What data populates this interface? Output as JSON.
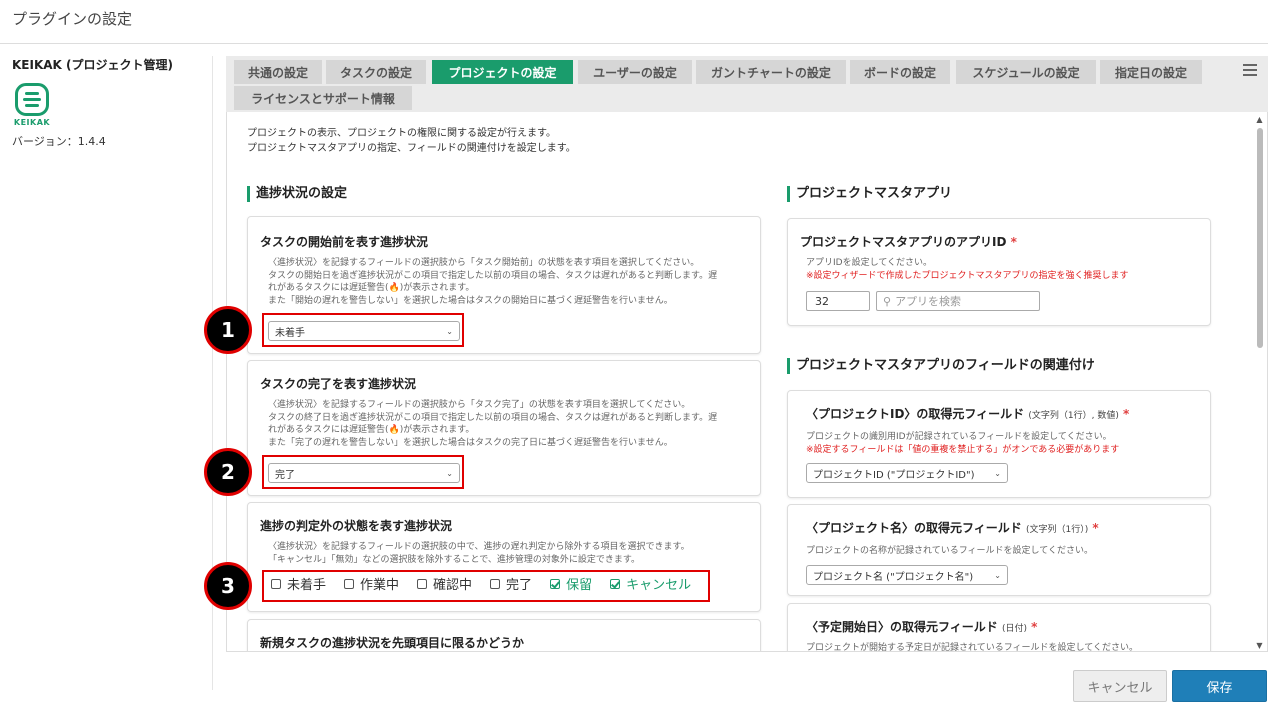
{
  "page_title": "プラグインの設定",
  "sidebar": {
    "plugin_name": "KEIKAK (プロジェクト管理)",
    "logo_text": "KEIKAK",
    "version": "バージョン：1.4.4"
  },
  "tabs": [
    {
      "label": "共通の設定",
      "active": false
    },
    {
      "label": "タスクの設定",
      "active": false
    },
    {
      "label": "プロジェクトの設定",
      "active": true
    },
    {
      "label": "ユーザーの設定",
      "active": false
    },
    {
      "label": "ガントチャートの設定",
      "active": false
    },
    {
      "label": "ボードの設定",
      "active": false
    },
    {
      "label": "スケジュールの設定",
      "active": false
    },
    {
      "label": "指定日の設定",
      "active": false
    },
    {
      "label": "ライセンスとサポート情報",
      "active": false
    }
  ],
  "intro": {
    "line1": "プロジェクトの表示、プロジェクトの権限に関する設定が行えます。",
    "line2": "プロジェクトマスタアプリの指定、フィールドの関連付けを設定します。"
  },
  "left_section": {
    "title": "進捗状況の設定",
    "start_card": {
      "title": "タスクの開始前を表す進捗状況",
      "desc1": "〈進捗状況〉を記録するフィールドの選択肢から「タスク開始前」の状態を表す項目を選択してください。",
      "desc2": "タスクの開始日を過ぎ進捗状況がこの項目で指定した以前の項目の場合、タスクは遅れがあると判断します。遅",
      "desc3": "れがあるタスクには遅延警告(🔥)が表示されます。",
      "desc4": "また「開始の遅れを警告しない」を選択した場合はタスクの開始日に基づく遅延警告を行いません。",
      "select_value": "未着手"
    },
    "end_card": {
      "title": "タスクの完了を表す進捗状況",
      "desc1": "〈進捗状況〉を記録するフィールドの選択肢から「タスク完了」の状態を表す項目を選択してください。",
      "desc2": "タスクの終了日を過ぎ進捗状況がこの項目で指定した以前の項目の場合、タスクは遅れがあると判断します。遅",
      "desc3": "れがあるタスクには遅延警告(🔥)が表示されます。",
      "desc4": "また「完了の遅れを警告しない」を選択した場合はタスクの完了日に基づく遅延警告を行いません。",
      "select_value": "完了"
    },
    "exclude_card": {
      "title": "進捗の判定外の状態を表す進捗状況",
      "desc1": "〈進捗状況〉を記録するフィールドの選択肢の中で、進捗の遅れ判定から除外する項目を選択できます。",
      "desc2": "「キャンセル」「無効」などの選択肢を除外することで、進捗管理の対象外に設定できます。",
      "options": [
        {
          "label": "未着手",
          "checked": false
        },
        {
          "label": "作業中",
          "checked": false
        },
        {
          "label": "確認中",
          "checked": false
        },
        {
          "label": "完了",
          "checked": false
        },
        {
          "label": "保留",
          "checked": true
        },
        {
          "label": "キャンセル",
          "checked": true
        }
      ]
    },
    "new_task_card": {
      "title": "新規タスクの進捗状況を先頭項目に限るかどうか"
    }
  },
  "right_section": {
    "master_title": "プロジェクトマスタアプリ",
    "app_id_card": {
      "title": "プロジェクトマスタアプリのアプリID",
      "required": "*",
      "desc1": "アプリIDを設定してください。",
      "desc2": "※設定ウィザードで作成したプロジェクトマスタアプリの指定を強く推奨します",
      "id_value": "32",
      "search_placeholder": "アプリを検索"
    },
    "link_title": "プロジェクトマスタアプリのフィールドの関連付け",
    "pid_card": {
      "title": "〈プロジェクトID〉の取得元フィールド",
      "type": "(文字列（1行）, 数値)",
      "required": "*",
      "desc1": "プロジェクトの識別用IDが記録されているフィールドを設定してください。",
      "desc2": "※設定するフィールドは「値の重複を禁止する」がオンである必要があります",
      "select_value": "プロジェクトID (\"プロジェクトID\")"
    },
    "pname_card": {
      "title": "〈プロジェクト名〉の取得元フィールド",
      "type": "(文字列（1行）)",
      "required": "*",
      "desc1": "プロジェクトの名称が記録されているフィールドを設定してください。",
      "select_value": "プロジェクト名 (\"プロジェクト名\")"
    },
    "pstart_card": {
      "title": "〈予定開始日〉の取得元フィールド",
      "type": "(日付)",
      "required": "*",
      "desc1": "プロジェクトが開始する予定日が記録されているフィールドを設定してください。"
    }
  },
  "markers": [
    "1",
    "2",
    "3"
  ],
  "buttons": {
    "cancel": "キャンセル",
    "save": "保存"
  },
  "colors": {
    "accent": "#1a9c6c",
    "primary_button": "#1f7fb8",
    "highlight": "#e00000",
    "warning": "#e02020"
  }
}
